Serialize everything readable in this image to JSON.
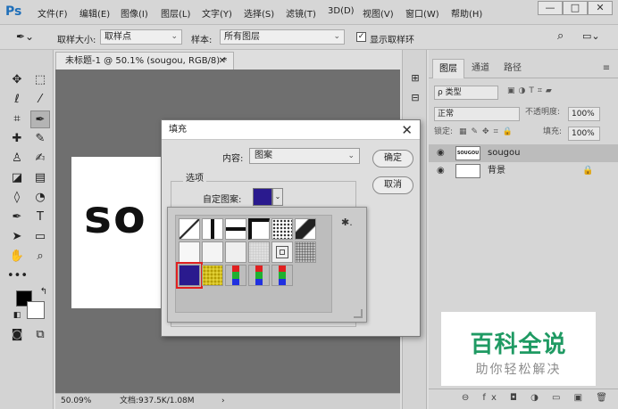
{
  "app": {
    "logo": "Ps",
    "menu": [
      "文件(F)",
      "编辑(E)",
      "图像(I)",
      "图层(L)",
      "文字(Y)",
      "选择(S)",
      "滤镜(T)",
      "3D(D)",
      "视图(V)",
      "窗口(W)",
      "帮助(H)"
    ],
    "window_buttons": [
      "—",
      "□",
      "✕"
    ]
  },
  "options_bar": {
    "sample_size_label": "取样大小:",
    "sample_size_value": "取样点",
    "sample_label": "样本:",
    "sample_value": "所有图层",
    "show_ring_label": "显示取样环",
    "show_ring_checked": "✓"
  },
  "document": {
    "tab_title": "未标题-1 @ 50.1% (sougou, RGB/8) *",
    "tab_close": "✕",
    "canvas_text": "so",
    "zoom": "50.09%",
    "doc_info": "文档:937.5K/1.08M",
    "status_arrow": "›"
  },
  "layers_panel": {
    "tabs": [
      "图层",
      "通道",
      "路径"
    ],
    "filter_label": "ρ 类型",
    "blend_mode": "正常",
    "opacity_label": "不透明度:",
    "opacity_value": "100%",
    "lock_label": "锁定:",
    "fill_label": "填充:",
    "fill_value": "100%",
    "layers": [
      {
        "name": "sougou",
        "thumb": "SOUGOU"
      },
      {
        "name": "背景",
        "lock": "🔒"
      }
    ],
    "footer_icons": "⊖ fx ◘ ◑ ▭ ▣ 🗑"
  },
  "fill_dialog": {
    "title": "填充",
    "close": "✕",
    "content_label": "内容:",
    "content_value": "图案",
    "ok_label": "确定",
    "cancel_label": "取消",
    "options_label": "选项",
    "custom_pattern_label": "自定图案:"
  },
  "pattern_picker": {
    "gear": "✱."
  },
  "watermark": {
    "title": "百科全说",
    "subtitle": "助你轻松解决"
  },
  "colors": {
    "accent": "#1f6fb9",
    "watermark_green": "#1f9a63",
    "selected_pattern": "#2a1a8e",
    "selection_border": "#e02020"
  }
}
